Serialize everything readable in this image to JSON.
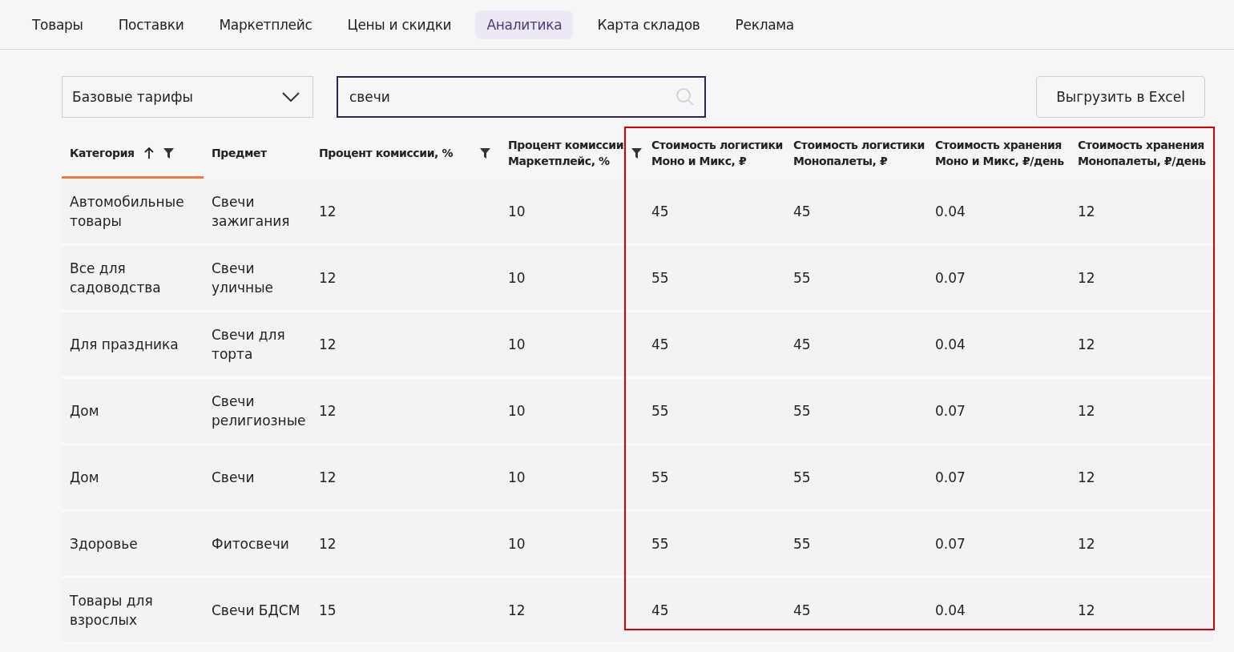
{
  "tabs": [
    {
      "label": "Товары",
      "selected": false
    },
    {
      "label": "Поставки",
      "selected": false
    },
    {
      "label": "Маркетплейс",
      "selected": false
    },
    {
      "label": "Цены и скидки",
      "selected": false
    },
    {
      "label": "Аналитика",
      "selected": true
    },
    {
      "label": "Карта складов",
      "selected": false
    },
    {
      "label": "Реклама",
      "selected": false
    }
  ],
  "toolbar": {
    "tariff_select": "Базовые тарифы",
    "search_value": "свечи",
    "export_button": "Выгрузить в Excel"
  },
  "table": {
    "columns": [
      {
        "label": "Категория",
        "sorted": true,
        "filter": true
      },
      {
        "label": "Предмет",
        "sorted": false,
        "filter": false
      },
      {
        "label": "Процент комиссии, %",
        "sorted": false,
        "filter": true
      },
      {
        "label": "Процент комиссии Маркетплейс, %",
        "sorted": false,
        "filter": true
      },
      {
        "label": "Стоимость логистики Моно и Микс, ₽",
        "sorted": false,
        "filter": false
      },
      {
        "label": "Стоимость логистики Монопалеты, ₽",
        "sorted": false,
        "filter": false
      },
      {
        "label": "Стоимость хранения Моно и Микс, ₽/день",
        "sorted": false,
        "filter": false
      },
      {
        "label": "Стоимость хранения Монопалеты, ₽/день",
        "sorted": false,
        "filter": false
      }
    ],
    "rows": [
      [
        "Автомобильные товары",
        "Свечи зажигания",
        "12",
        "10",
        "45",
        "45",
        "0.04",
        "12"
      ],
      [
        "Все для садоводства",
        "Свечи уличные",
        "12",
        "10",
        "55",
        "55",
        "0.07",
        "12"
      ],
      [
        "Для праздника",
        "Свечи для торта",
        "12",
        "10",
        "45",
        "45",
        "0.04",
        "12"
      ],
      [
        "Дом",
        "Свечи религиозные",
        "12",
        "10",
        "55",
        "55",
        "0.07",
        "12"
      ],
      [
        "Дом",
        "Свечи",
        "12",
        "10",
        "55",
        "55",
        "0.07",
        "12"
      ],
      [
        "Здоровье",
        "Фитосвечи",
        "12",
        "10",
        "55",
        "55",
        "0.07",
        "12"
      ],
      [
        "Товары для взрослых",
        "Свечи БДСМ",
        "15",
        "12",
        "45",
        "45",
        "0.04",
        "12"
      ]
    ]
  }
}
